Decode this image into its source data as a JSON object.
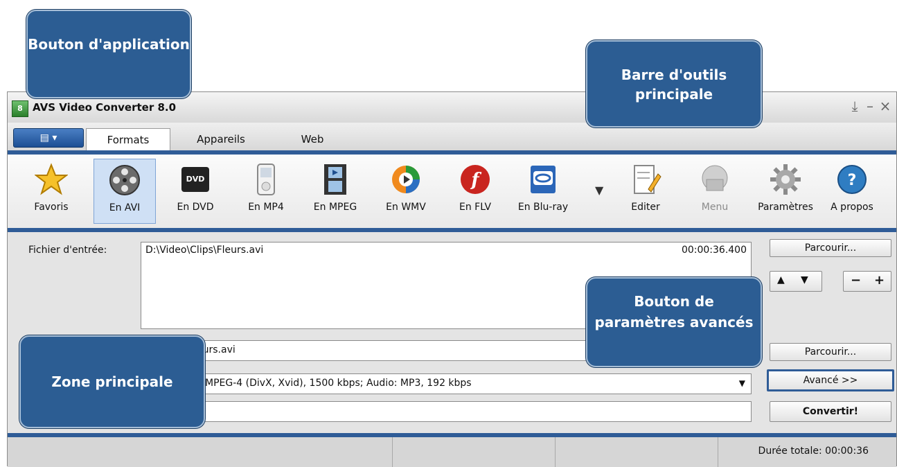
{
  "window": {
    "title": "AVS Video Converter 8.0"
  },
  "tabs": [
    {
      "label": "Formats",
      "active": true
    },
    {
      "label": "Appareils",
      "active": false
    },
    {
      "label": "Web",
      "active": false
    }
  ],
  "ribbon": [
    {
      "label": "Favoris",
      "icon": "star-icon"
    },
    {
      "label": "En AVI",
      "icon": "film-reel-icon",
      "active": true
    },
    {
      "label": "En DVD",
      "icon": "dvd-icon"
    },
    {
      "label": "En MP4",
      "icon": "mp4-player-icon"
    },
    {
      "label": "En MPEG",
      "icon": "film-strip-icon"
    },
    {
      "label": "En WMV",
      "icon": "wmv-icon"
    },
    {
      "label": "En FLV",
      "icon": "flash-icon"
    },
    {
      "label": "En Blu-ray",
      "icon": "bluray-icon"
    },
    {
      "label": "Editer",
      "icon": "edit-icon"
    },
    {
      "label": "Menu",
      "icon": "menu-disc-icon",
      "disabled": true
    },
    {
      "label": "Paramètres",
      "icon": "gear-icon"
    },
    {
      "label": "A propos",
      "icon": "help-icon"
    }
  ],
  "main": {
    "input_label": "Fichier d'entrée:",
    "input_file": "D:\\Video\\Clips\\Fleurs.avi",
    "input_duration": "00:00:36.400",
    "output_file_visible": "eurs.avi",
    "profile_visible": "MPEG-4 (DivX, Xvid), 1500 kbps; Audio: MP3, 192 kbps",
    "browse_label": "Parcourir...",
    "browse2_label": "Parcourir...",
    "advanced_label": "Avancé >>",
    "convert_label": "Convertir!",
    "minus_label": "−",
    "plus_label": "+"
  },
  "status": {
    "total_duration": "Durée totale: 00:00:36"
  },
  "callouts": {
    "app_button": "Bouton d'application",
    "toolbar": "Barre d'outils principale",
    "main_zone": "Zone principale",
    "advanced": "Bouton de paramètres avancés"
  },
  "colors": {
    "accent": "#2f5c97",
    "callout": "#2c5d93"
  }
}
